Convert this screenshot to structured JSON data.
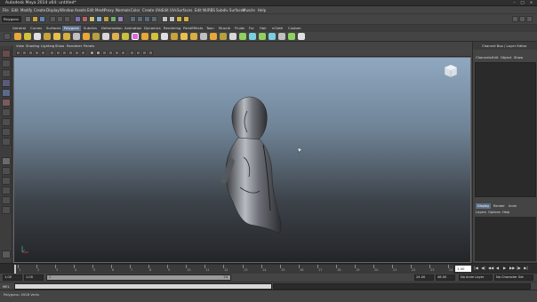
{
  "window": {
    "title": "Autodesk Maya 2014 x64: untitled*",
    "controls": [
      "–",
      "□",
      "×"
    ]
  },
  "menubar": {
    "items": [
      "File",
      "Edit",
      "Modify",
      "Create",
      "Display",
      "Window",
      "Assets",
      "Edit Mesh",
      "Proxy",
      "Normals",
      "Color",
      "Create UVs",
      "Edit UVs",
      "Surfaces",
      "Edit NURBS",
      "Subdiv Surfaces",
      "Muscle",
      "Help"
    ]
  },
  "statusline": {
    "mode": "Polygons"
  },
  "shelf": {
    "tabs": [
      "General",
      "Curves",
      "Surfaces",
      "Polygons",
      "Subdivs",
      "Deformation",
      "Animation",
      "Dynamics",
      "Rendering",
      "PaintEffects",
      "Toon",
      "Muscle",
      "Fluids",
      "Fur",
      "Hair",
      "nCloth",
      "Custom"
    ],
    "active_tab": "Polygons",
    "icon_colors": [
      "#e8a838",
      "#d4c23a",
      "#e0e0e0",
      "#c8a23a",
      "#4fb0d0",
      "#d86ad8",
      "#e0e0e0",
      "#c8c040",
      "#b8a040",
      "#d8d8d8",
      "#e8b050",
      "#8fd060",
      "#c0c0c0",
      "#e8a838",
      "#7ad0e0",
      "#d4c23a"
    ]
  },
  "viewport": {
    "menus": [
      "View",
      "Shading",
      "Lighting",
      "Show",
      "Renderer",
      "Panels"
    ],
    "gradient_top": "#8fa8c1",
    "gradient_bottom": "#232528",
    "axis": {
      "x": "x",
      "y": "y",
      "z": "z"
    }
  },
  "channelbox": {
    "title": "Channel Box / Layer Editor",
    "menus": [
      "Channels",
      "Edit",
      "Object",
      "Show"
    ]
  },
  "layers": {
    "tabs": [
      "Display",
      "Render",
      "Anim"
    ],
    "active_tab": "Display",
    "menus": [
      "Layers",
      "Options",
      "Help"
    ]
  },
  "timeslider": {
    "ticks": [
      "1",
      "2",
      "3",
      "4",
      "5",
      "6",
      "7",
      "8",
      "9",
      "10",
      "11",
      "12",
      "13",
      "14",
      "15",
      "16",
      "17",
      "18",
      "19",
      "20",
      "21",
      "22",
      "23",
      "24"
    ],
    "current_frame": "1.00",
    "playback_buttons": [
      "|◀",
      "◀|",
      "◀◀",
      "◀",
      "▶",
      "▶▶",
      "|▶",
      "▶|"
    ]
  },
  "rangeslider": {
    "start": "1.00",
    "inner_start": "1.00",
    "bar_start": "1",
    "bar_end": "24",
    "inner_end": "24.00",
    "end": "48.00",
    "anim_layer": "No Anim Layer",
    "character": "No Character Set"
  },
  "cmdline": {
    "label": "MEL"
  },
  "helpline": {
    "text": "Polygons: 4928 Verts"
  }
}
